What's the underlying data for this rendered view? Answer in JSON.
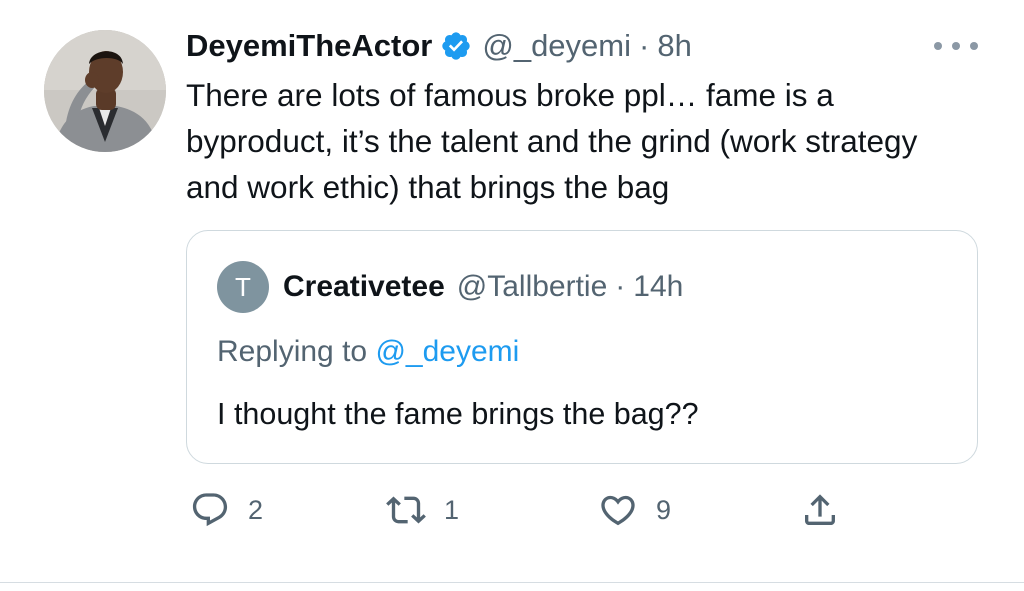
{
  "tweet": {
    "author": {
      "display_name": "DeyemiTheActor",
      "handle": "@_deyemi",
      "verified": true
    },
    "separator": "·",
    "time": "8h",
    "text": "There are lots of famous broke ppl… fame is a byproduct, it’s the talent and the grind (work strategy and work ethic) that brings the bag"
  },
  "quoted_tweet": {
    "avatar_initial": "T",
    "display_name": "Creativetee",
    "handle": "@Tallbertie",
    "separator": "·",
    "time": "14h",
    "replying_prefix": "Replying to ",
    "replying_to": "@_deyemi",
    "text": "I thought the fame brings the bag??"
  },
  "actions": {
    "reply_count": "2",
    "retweet_count": "1",
    "like_count": "9"
  },
  "icons": {
    "verified": "verified-badge-icon",
    "more": "more-options-icon",
    "reply": "reply-icon",
    "retweet": "retweet-icon",
    "like": "heart-icon",
    "share": "share-icon"
  },
  "colors": {
    "primary_text": "#0f1419",
    "secondary_text": "#536471",
    "accent_blue": "#1d9bf0",
    "border": "#cfd9de",
    "quoted_avatar_bg": "#7f949f"
  }
}
